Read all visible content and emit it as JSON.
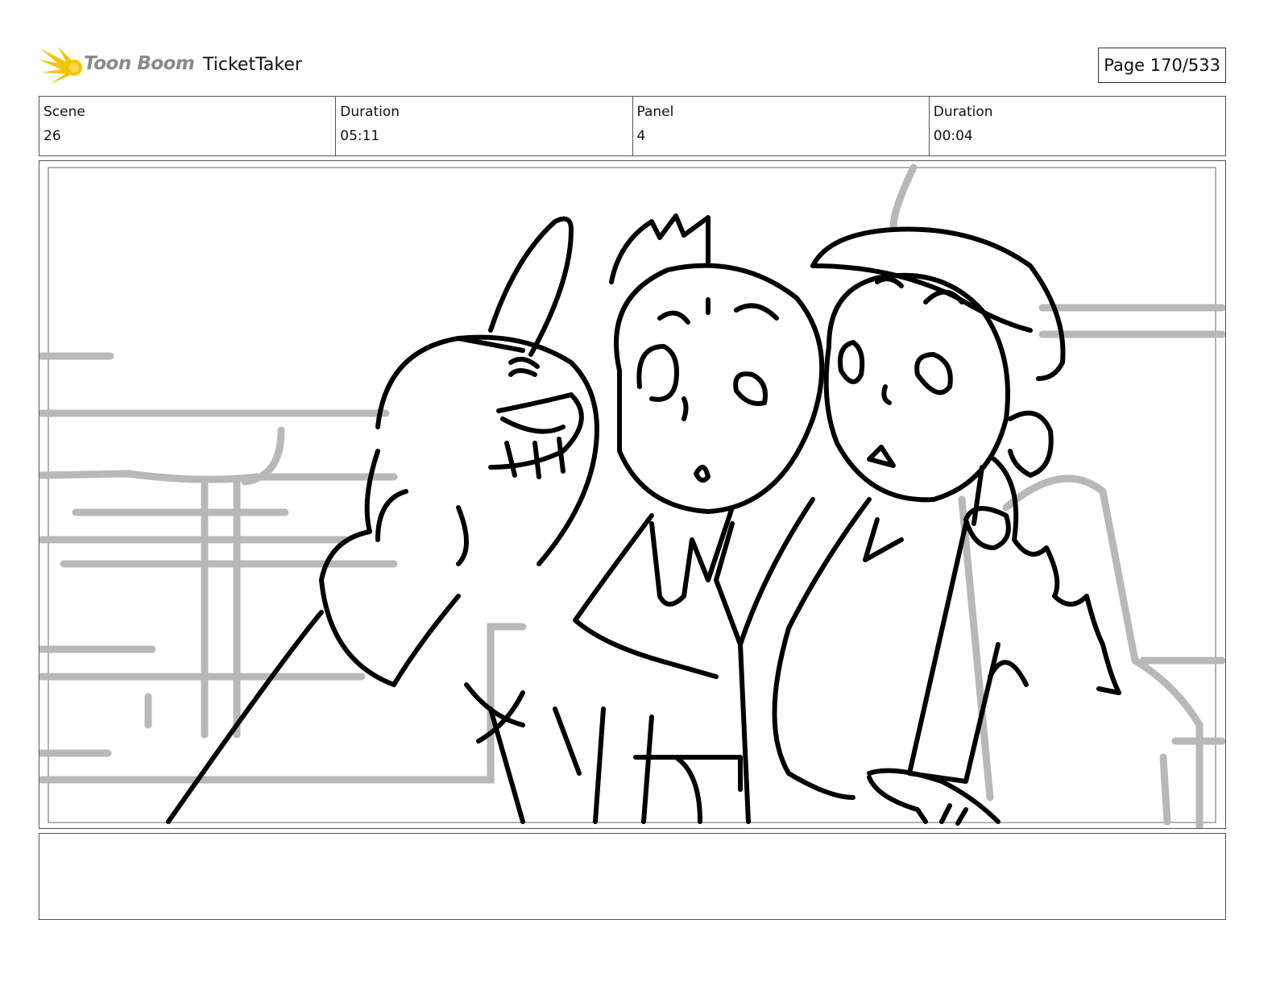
{
  "header": {
    "brand_name": "Toon Boom",
    "project_title": "TicketTaker",
    "page_indicator": "Page 170/533"
  },
  "info": [
    {
      "label": "Scene",
      "value": "26"
    },
    {
      "label": "Duration",
      "value": "05:11"
    },
    {
      "label": "Panel",
      "value": "4"
    },
    {
      "label": "Duration",
      "value": "00:04"
    }
  ],
  "colors": {
    "logo_yellow": "#f5c400",
    "logo_text_gray": "#8a8a8a",
    "sketch_line": "#000000",
    "background_sketch": "#b8b8b8"
  },
  "notes": ""
}
